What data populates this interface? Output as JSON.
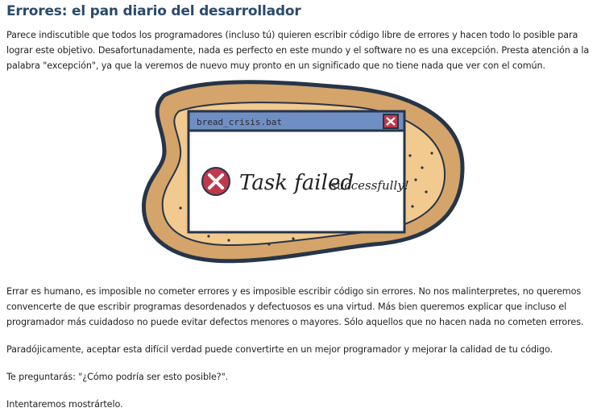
{
  "article": {
    "title": "Errores: el pan diario del desarrollador",
    "intro": "Parece indiscutible que todos los programadores (incluso tú) quieren escribir código libre de errores y hacen todo lo posible para lograr este objetivo. Desafortunadamente, nada es perfecto en este mundo y el software no es una excepción. Presta atención a la palabra \"excepción\", ya que la veremos de nuevo muy pronto en un significado que no tiene nada que ver con el común.",
    "paragraph_2": "Errar es humano, es imposible no cometer errores y es imposible escribir código sin errores. No nos malinterpretes, no queremos convencerte de que escribir programas desordenados y defectuosos es una virtud. Más bien queremos explicar que incluso el programador más cuidadoso no puede evitar defectos menores o mayores. Sólo aquellos que no hacen nada no cometen errores.",
    "paragraph_3": "Paradójicamente, aceptar esta difícil verdad puede convertirte en un mejor programador y mejorar la calidad de tu código.",
    "paragraph_4": "Te preguntarás: \"¿Cómo podría ser esto posible?\".",
    "paragraph_5": "Intentaremos mostrártelo."
  },
  "illustration": {
    "window_title": "bread_crisis.bat",
    "message_main": "Task failed",
    "message_tail": "successfully!",
    "icons": [
      "error-icon",
      "close-icon"
    ]
  },
  "colors": {
    "title": "#2b4a6b",
    "bread_crust": "#d4a46a",
    "bread_outline": "#263548",
    "window_titlebar": "#6f8fc4",
    "error_red": "#c0394a"
  }
}
